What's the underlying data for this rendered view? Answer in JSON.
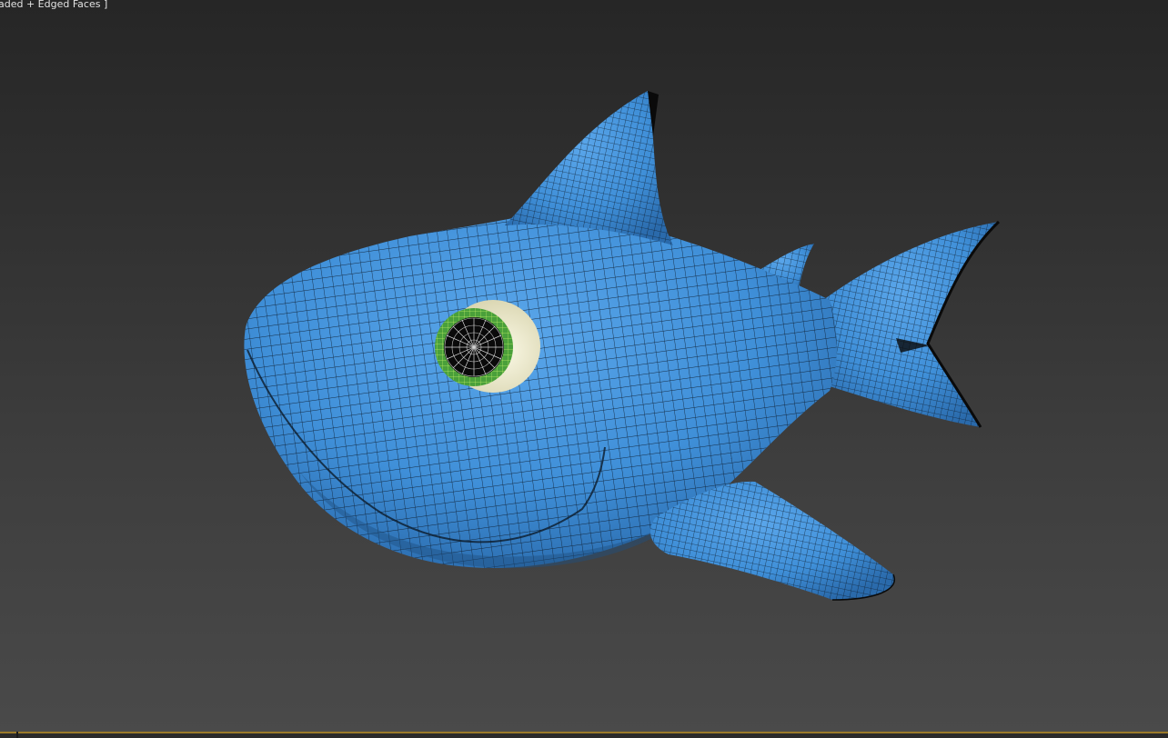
{
  "viewport": {
    "label": "aded + Edged Faces ]"
  },
  "colors": {
    "body": "#3f8fd8",
    "body_dark": "#2d6fb0",
    "wire": "#0d1b2b",
    "eye_white": "#f3f0d6",
    "iris": "#4aa03a",
    "iris_wire": "#d8ff70",
    "pupil": "#0a0a0a",
    "timeline": "#9a7a2a"
  },
  "icons": {
    "model": "shark-model"
  }
}
